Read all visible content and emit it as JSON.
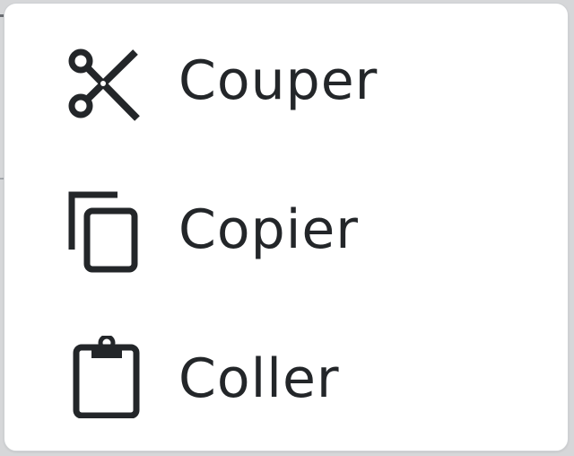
{
  "context_menu": {
    "items": [
      {
        "label": "Couper",
        "icon": "scissors-icon"
      },
      {
        "label": "Copier",
        "icon": "copy-icon"
      },
      {
        "label": "Coller",
        "icon": "clipboard-icon"
      }
    ]
  },
  "colors": {
    "text": "#232629",
    "icon": "#232629",
    "menu_background": "#ffffff",
    "menu_border": "#cfd1d4",
    "backdrop": "#d6d7d9"
  }
}
